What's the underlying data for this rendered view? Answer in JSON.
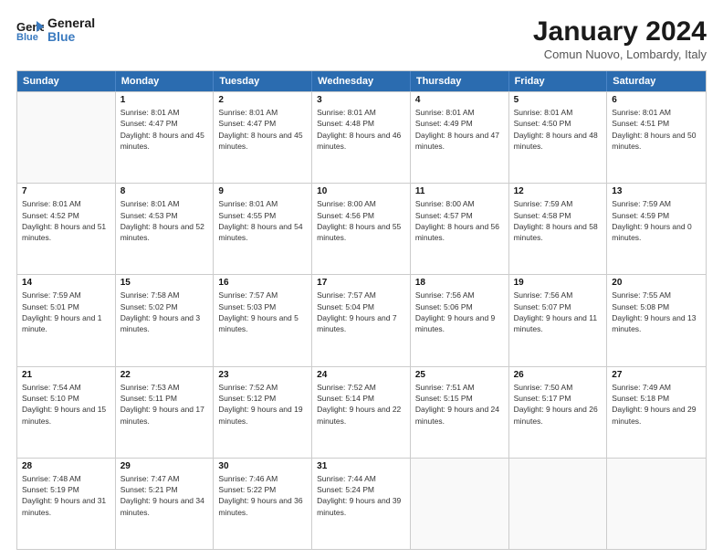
{
  "header": {
    "logo_line1": "General",
    "logo_line2": "Blue",
    "month_title": "January 2024",
    "subtitle": "Comun Nuovo, Lombardy, Italy"
  },
  "weekdays": [
    "Sunday",
    "Monday",
    "Tuesday",
    "Wednesday",
    "Thursday",
    "Friday",
    "Saturday"
  ],
  "rows": [
    [
      {
        "date": "",
        "sunrise": "",
        "sunset": "",
        "daylight": ""
      },
      {
        "date": "1",
        "sunrise": "8:01 AM",
        "sunset": "4:47 PM",
        "daylight": "8 hours and 45 minutes."
      },
      {
        "date": "2",
        "sunrise": "8:01 AM",
        "sunset": "4:47 PM",
        "daylight": "8 hours and 45 minutes."
      },
      {
        "date": "3",
        "sunrise": "8:01 AM",
        "sunset": "4:48 PM",
        "daylight": "8 hours and 46 minutes."
      },
      {
        "date": "4",
        "sunrise": "8:01 AM",
        "sunset": "4:49 PM",
        "daylight": "8 hours and 47 minutes."
      },
      {
        "date": "5",
        "sunrise": "8:01 AM",
        "sunset": "4:50 PM",
        "daylight": "8 hours and 48 minutes."
      },
      {
        "date": "6",
        "sunrise": "8:01 AM",
        "sunset": "4:51 PM",
        "daylight": "8 hours and 50 minutes."
      }
    ],
    [
      {
        "date": "7",
        "sunrise": "8:01 AM",
        "sunset": "4:52 PM",
        "daylight": "8 hours and 51 minutes."
      },
      {
        "date": "8",
        "sunrise": "8:01 AM",
        "sunset": "4:53 PM",
        "daylight": "8 hours and 52 minutes."
      },
      {
        "date": "9",
        "sunrise": "8:01 AM",
        "sunset": "4:55 PM",
        "daylight": "8 hours and 54 minutes."
      },
      {
        "date": "10",
        "sunrise": "8:00 AM",
        "sunset": "4:56 PM",
        "daylight": "8 hours and 55 minutes."
      },
      {
        "date": "11",
        "sunrise": "8:00 AM",
        "sunset": "4:57 PM",
        "daylight": "8 hours and 56 minutes."
      },
      {
        "date": "12",
        "sunrise": "7:59 AM",
        "sunset": "4:58 PM",
        "daylight": "8 hours and 58 minutes."
      },
      {
        "date": "13",
        "sunrise": "7:59 AM",
        "sunset": "4:59 PM",
        "daylight": "9 hours and 0 minutes."
      }
    ],
    [
      {
        "date": "14",
        "sunrise": "7:59 AM",
        "sunset": "5:01 PM",
        "daylight": "9 hours and 1 minute."
      },
      {
        "date": "15",
        "sunrise": "7:58 AM",
        "sunset": "5:02 PM",
        "daylight": "9 hours and 3 minutes."
      },
      {
        "date": "16",
        "sunrise": "7:57 AM",
        "sunset": "5:03 PM",
        "daylight": "9 hours and 5 minutes."
      },
      {
        "date": "17",
        "sunrise": "7:57 AM",
        "sunset": "5:04 PM",
        "daylight": "9 hours and 7 minutes."
      },
      {
        "date": "18",
        "sunrise": "7:56 AM",
        "sunset": "5:06 PM",
        "daylight": "9 hours and 9 minutes."
      },
      {
        "date": "19",
        "sunrise": "7:56 AM",
        "sunset": "5:07 PM",
        "daylight": "9 hours and 11 minutes."
      },
      {
        "date": "20",
        "sunrise": "7:55 AM",
        "sunset": "5:08 PM",
        "daylight": "9 hours and 13 minutes."
      }
    ],
    [
      {
        "date": "21",
        "sunrise": "7:54 AM",
        "sunset": "5:10 PM",
        "daylight": "9 hours and 15 minutes."
      },
      {
        "date": "22",
        "sunrise": "7:53 AM",
        "sunset": "5:11 PM",
        "daylight": "9 hours and 17 minutes."
      },
      {
        "date": "23",
        "sunrise": "7:52 AM",
        "sunset": "5:12 PM",
        "daylight": "9 hours and 19 minutes."
      },
      {
        "date": "24",
        "sunrise": "7:52 AM",
        "sunset": "5:14 PM",
        "daylight": "9 hours and 22 minutes."
      },
      {
        "date": "25",
        "sunrise": "7:51 AM",
        "sunset": "5:15 PM",
        "daylight": "9 hours and 24 minutes."
      },
      {
        "date": "26",
        "sunrise": "7:50 AM",
        "sunset": "5:17 PM",
        "daylight": "9 hours and 26 minutes."
      },
      {
        "date": "27",
        "sunrise": "7:49 AM",
        "sunset": "5:18 PM",
        "daylight": "9 hours and 29 minutes."
      }
    ],
    [
      {
        "date": "28",
        "sunrise": "7:48 AM",
        "sunset": "5:19 PM",
        "daylight": "9 hours and 31 minutes."
      },
      {
        "date": "29",
        "sunrise": "7:47 AM",
        "sunset": "5:21 PM",
        "daylight": "9 hours and 34 minutes."
      },
      {
        "date": "30",
        "sunrise": "7:46 AM",
        "sunset": "5:22 PM",
        "daylight": "9 hours and 36 minutes."
      },
      {
        "date": "31",
        "sunrise": "7:44 AM",
        "sunset": "5:24 PM",
        "daylight": "9 hours and 39 minutes."
      },
      {
        "date": "",
        "sunrise": "",
        "sunset": "",
        "daylight": ""
      },
      {
        "date": "",
        "sunrise": "",
        "sunset": "",
        "daylight": ""
      },
      {
        "date": "",
        "sunrise": "",
        "sunset": "",
        "daylight": ""
      }
    ]
  ]
}
